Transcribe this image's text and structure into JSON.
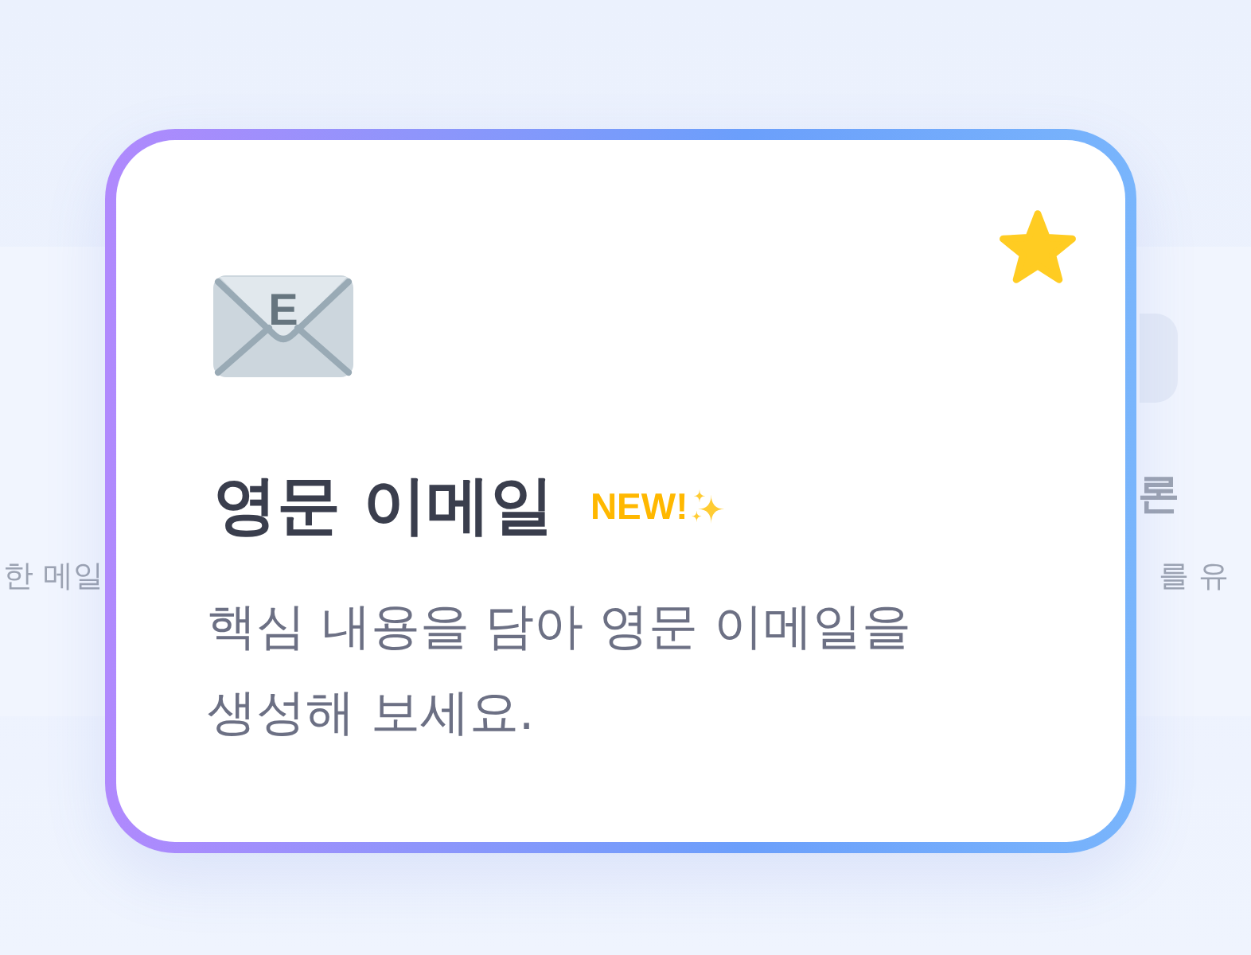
{
  "carousel": {
    "cards": [
      {
        "kind": "previous",
        "description": "한 메일"
      },
      {
        "kind": "current",
        "starred": true,
        "icon_letter": "E",
        "title": "영문 이메일",
        "badge": "NEW!",
        "description": "핵심 내용을 담아 영문 이메일을 생성해 보세요."
      },
      {
        "kind": "next",
        "title": "론",
        "description": "를 유"
      }
    ]
  }
}
